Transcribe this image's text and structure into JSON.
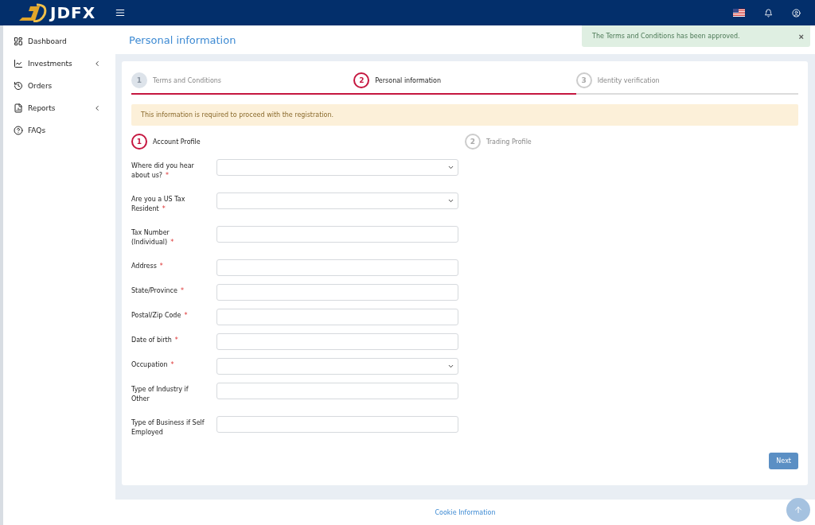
{
  "brand": {
    "name": "JDFX"
  },
  "sidebar": {
    "items": [
      {
        "label": "Dashboard",
        "expandable": false
      },
      {
        "label": "Investments",
        "expandable": true
      },
      {
        "label": "Orders",
        "expandable": false
      },
      {
        "label": "Reports",
        "expandable": true
      },
      {
        "label": "FAQs",
        "expandable": false
      }
    ]
  },
  "page_title": "Personal information",
  "toast": {
    "message": "The Terms and Conditions has been approved.",
    "close": "×"
  },
  "steps": [
    {
      "number": "1",
      "label": "Terms and Conditions",
      "selected": false,
      "completed": true
    },
    {
      "number": "2",
      "label": "Personal information",
      "selected": true,
      "completed": false
    },
    {
      "number": "3",
      "label": "Identity verification",
      "selected": false,
      "completed": false
    }
  ],
  "notice": "This information is required to proceed with the registration.",
  "substeps": [
    {
      "number": "1",
      "label": "Account Profile",
      "selected": true
    },
    {
      "number": "2",
      "label": "Trading Profile",
      "selected": false
    }
  ],
  "fields": [
    {
      "label": "Where did you hear about us?",
      "required_mark": "*",
      "kind": "select"
    },
    {
      "label": "Are you a US Tax Resident",
      "required_mark": "*",
      "kind": "select"
    },
    {
      "label": "Tax Number (Individual)",
      "required_mark": "*",
      "kind": "text"
    },
    {
      "label": "Address",
      "required_mark": "*",
      "kind": "text"
    },
    {
      "label": "State/Province",
      "required_mark": "*",
      "kind": "text"
    },
    {
      "label": "Postal/Zip Code",
      "required_mark": "*",
      "kind": "text"
    },
    {
      "label": "Date of birth",
      "required_mark": "*",
      "kind": "text"
    },
    {
      "label": "Occupation",
      "required_mark": "*",
      "kind": "select"
    },
    {
      "label": "Type of Industry if Other",
      "kind": "text"
    },
    {
      "label": "Type of Business if Self Employed",
      "kind": "text"
    }
  ],
  "next_button": "Next",
  "footer": {
    "link": "Cookie Information"
  }
}
